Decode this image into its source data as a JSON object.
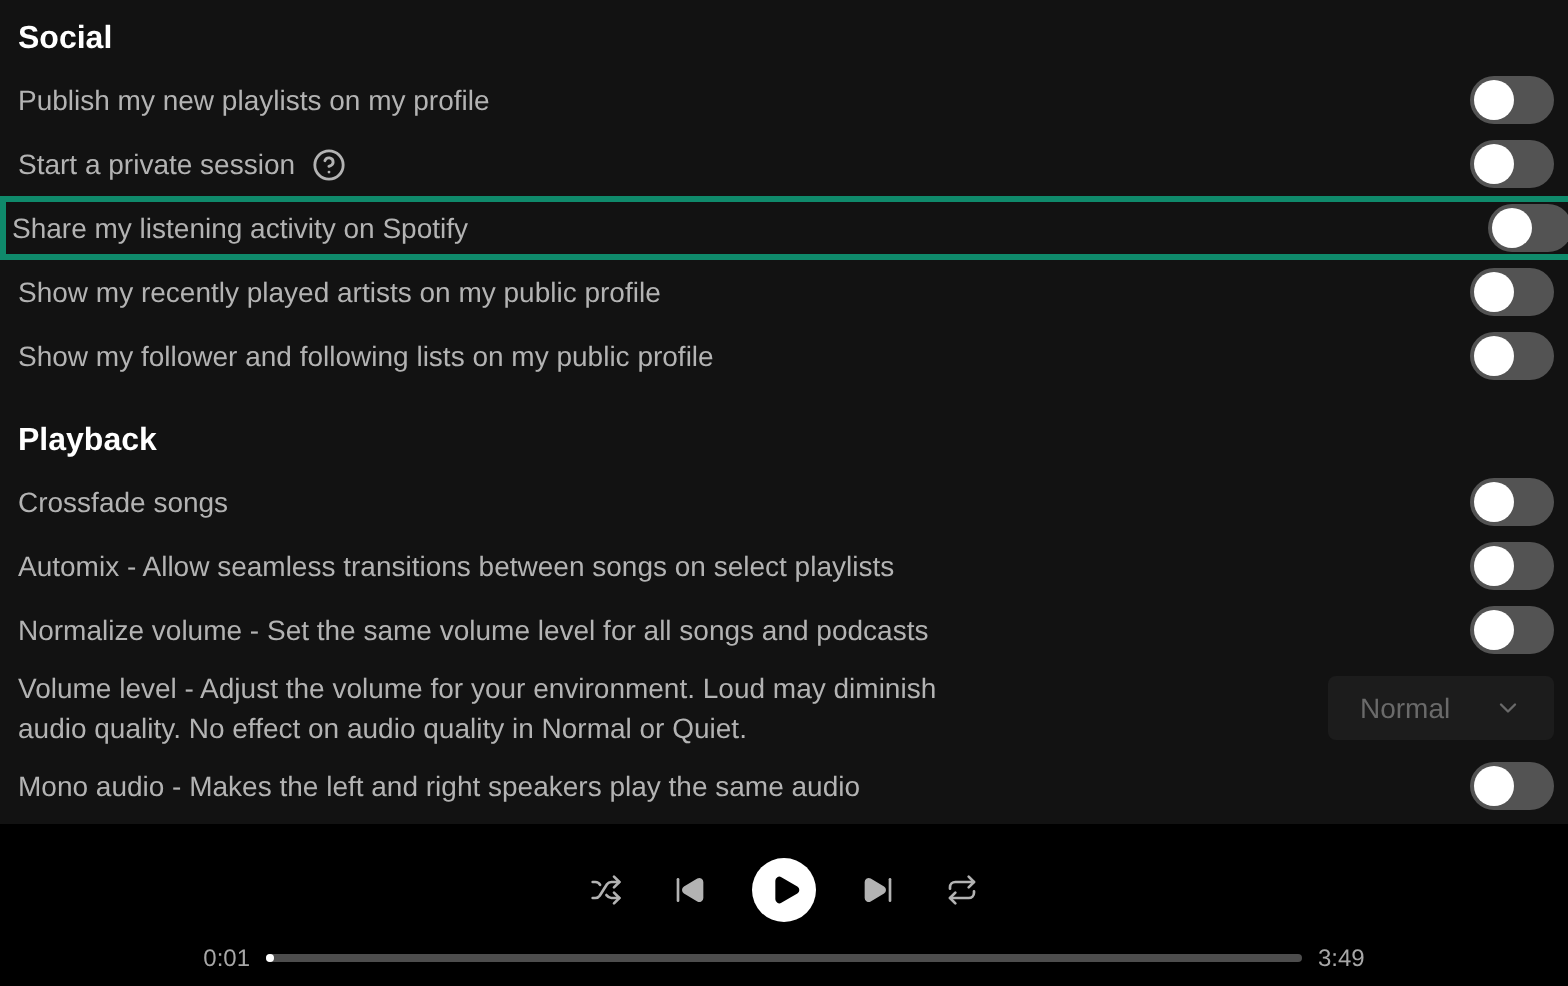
{
  "sections": [
    {
      "title": "Social",
      "items": [
        {
          "kind": "toggle",
          "label": "Publish my new playlists on my profile",
          "on": false,
          "focused": false
        },
        {
          "kind": "toggle",
          "label": "Start a private session",
          "help": true,
          "on": false,
          "focused": false
        },
        {
          "kind": "toggle",
          "label": "Share my listening activity on Spotify",
          "on": false,
          "focused": true
        },
        {
          "kind": "toggle",
          "label": "Show my recently played artists on my public profile",
          "on": false,
          "focused": false
        },
        {
          "kind": "toggle",
          "label": "Show my follower and following lists on my public profile",
          "on": false,
          "focused": false
        }
      ]
    },
    {
      "title": "Playback",
      "items": [
        {
          "kind": "toggle",
          "label": "Crossfade songs",
          "on": false,
          "focused": false
        },
        {
          "kind": "toggle",
          "label": "Automix - Allow seamless transitions between songs on select playlists",
          "on": false,
          "focused": false
        },
        {
          "kind": "toggle",
          "label": "Normalize volume - Set the same volume level for all songs and podcasts",
          "on": false,
          "focused": false
        },
        {
          "kind": "select",
          "label": "Volume level - Adjust the volume for your environment. Loud may diminish audio quality. No effect on audio quality in Normal or Quiet.",
          "value": "Normal",
          "disabled": true,
          "focused": false
        },
        {
          "kind": "toggle",
          "label": "Mono audio - Makes the left and right speakers play the same audio",
          "on": false,
          "focused": false
        }
      ]
    }
  ],
  "player": {
    "elapsed": "0:01",
    "duration": "3:49",
    "level": 0.004
  }
}
